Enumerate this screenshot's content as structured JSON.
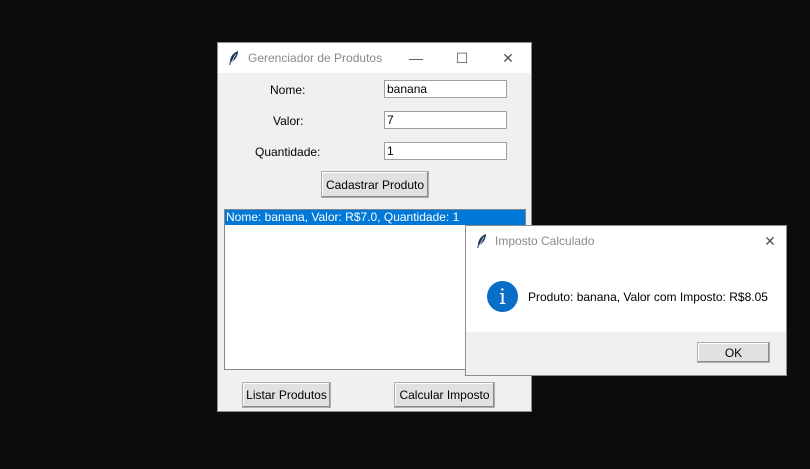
{
  "main_window": {
    "title": "Gerenciador de Produtos",
    "controls": {
      "minimize": "—",
      "maximize": "☐",
      "close": "✕"
    },
    "form": {
      "name_label": "Nome:",
      "name_value": "banana",
      "value_label": "Valor:",
      "value_value": "7",
      "quantity_label": "Quantidade:",
      "quantity_value": "1"
    },
    "register_button": "Cadastrar Produto",
    "product_list": [
      "Nome: banana, Valor: R$7.0, Quantidade: 1"
    ],
    "list_button": "Listar Produtos",
    "calculate_button": "Calcular Imposto"
  },
  "dialog": {
    "title": "Imposto Calculado",
    "close": "✕",
    "icon": "info-icon",
    "icon_glyph": "i",
    "message": "Produto: banana, Valor com Imposto: R$8.05",
    "ok_button": "OK"
  },
  "colors": {
    "selection": "#0078d7",
    "info_icon": "#0a6ec9",
    "desktop": "#0c0c0c"
  }
}
